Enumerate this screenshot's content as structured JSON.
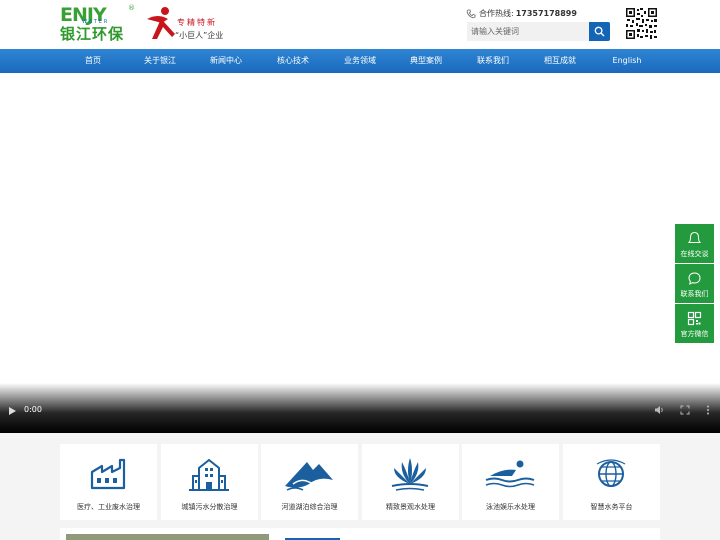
{
  "brand": {
    "logo_en": "ENJ",
    "logo_en_tail": "Y",
    "logo_reg": "®",
    "logo_water": "WATER",
    "logo_cn": "银江环保",
    "badge_line1": "专精特新",
    "badge_line2": "“小巨人”企业"
  },
  "header": {
    "hotline_label": "合作热线:",
    "hotline_number": "17357178899",
    "search_placeholder": "请输入关键词"
  },
  "nav": {
    "items": [
      {
        "label": "首页"
      },
      {
        "label": "关于银江"
      },
      {
        "label": "新闻中心"
      },
      {
        "label": "核心技术"
      },
      {
        "label": "业务领域"
      },
      {
        "label": "典型案例"
      },
      {
        "label": "联系我们"
      },
      {
        "label": "相互成就"
      },
      {
        "label": "English"
      }
    ]
  },
  "video": {
    "time": "0:00"
  },
  "sidebar": {
    "items": [
      {
        "label": "在线交谈",
        "icon": "chat-bubble-icon"
      },
      {
        "label": "联系我们",
        "icon": "contact-icon"
      },
      {
        "label": "官方微信",
        "icon": "qr-code-icon"
      }
    ]
  },
  "services": {
    "items": [
      {
        "label": "医疗、工业废水治理",
        "icon": "factory-icon"
      },
      {
        "label": "城镇污水分散治理",
        "icon": "town-buildings-icon"
      },
      {
        "label": "河道湖泊综合治理",
        "icon": "river-mountain-icon"
      },
      {
        "label": "精致景观水处理",
        "icon": "fountain-icon"
      },
      {
        "label": "泳池娱乐水处理",
        "icon": "swimmer-icon"
      },
      {
        "label": "智慧水务平台",
        "icon": "globe-icon"
      }
    ]
  },
  "colors": {
    "brand_green": "#3aa035",
    "nav_blue": "#1a6abd",
    "sidebar_green": "#239a3d",
    "icon_blue": "#1b5f9e"
  }
}
